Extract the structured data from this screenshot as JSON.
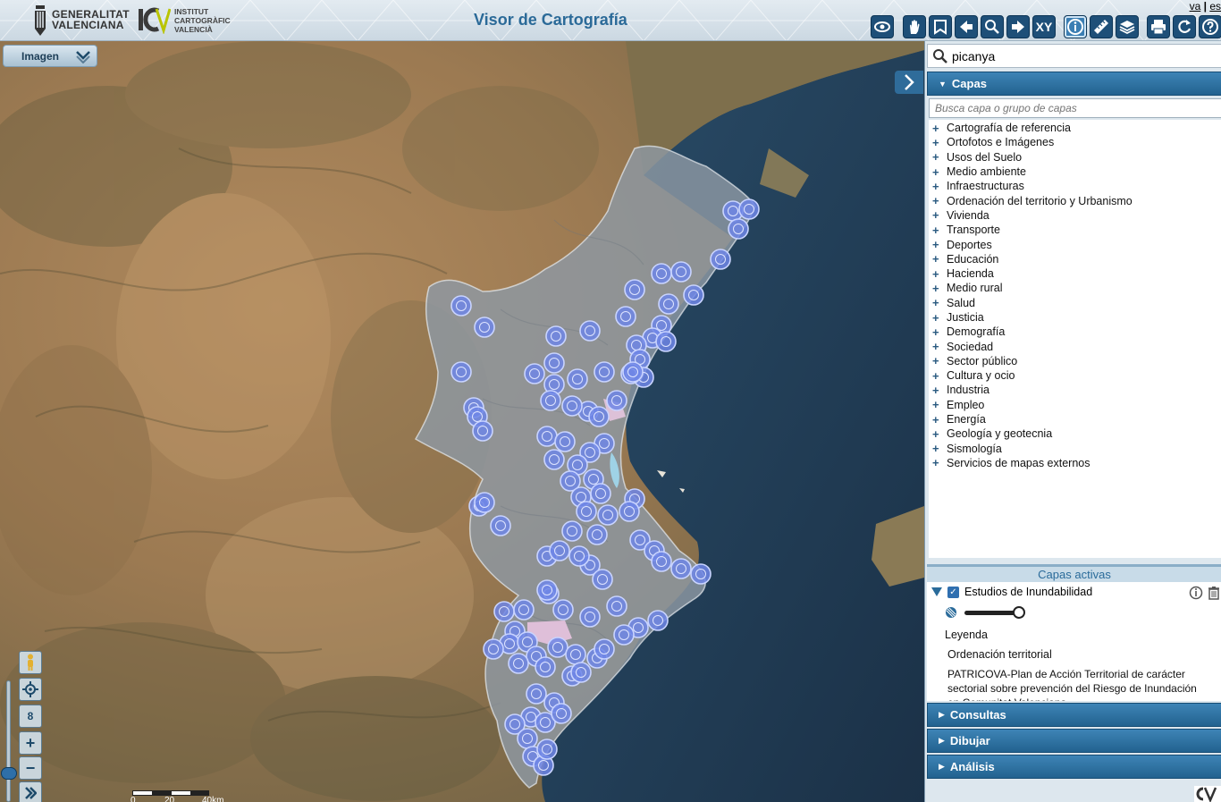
{
  "header": {
    "gva_name": [
      "GENERALITAT",
      "VALENCIANA"
    ],
    "icv_name": [
      "INSTITUT",
      "CARTOGRÀFIC",
      "VALENCIÀ"
    ],
    "title": "Visor de Cartografía",
    "lang": {
      "va": "va",
      "separator": "|",
      "es": "es"
    }
  },
  "toolbar": {
    "tools": [
      {
        "name": "eye-icon"
      },
      {
        "name": "hand-icon"
      },
      {
        "name": "bookmark-icon"
      },
      {
        "name": "arrow-left-icon"
      },
      {
        "name": "zoom-extent-icon"
      },
      {
        "name": "arrow-right-icon"
      },
      {
        "name": "xy-label",
        "label": "XY"
      },
      {
        "name": "info-icon"
      },
      {
        "name": "ruler-icon"
      },
      {
        "name": "layers-icon"
      },
      {
        "name": "print-icon"
      },
      {
        "name": "refresh-icon"
      },
      {
        "name": "help-icon"
      }
    ],
    "active_tool": "info-icon"
  },
  "map": {
    "basemap_label": "Imagen",
    "zoom_level": "8",
    "scale_labels": [
      "0",
      "20",
      "40km"
    ]
  },
  "panel": {
    "search_value": "picanya",
    "capas_title": "Capas",
    "filter_placeholder": "Busca capa o grupo de capas",
    "layer_groups": [
      "Cartografía de referencia",
      "Ortofotos e Imágenes",
      "Usos del Suelo",
      "Medio ambiente",
      "Infraestructuras",
      "Ordenación del territorio y Urbanismo",
      "Vivienda",
      "Transporte",
      "Deportes",
      "Educación",
      "Hacienda",
      "Medio rural",
      "Salud",
      "Justicia",
      "Demografía",
      "Sociedad",
      "Sector público",
      "Cultura y ocio",
      "Industria",
      "Empleo",
      "Energía",
      "Geología y geotecnia",
      "Sismología",
      "Servicios de mapas externos"
    ],
    "active_title": "Capas activas",
    "active_layer": {
      "name": "Estudios de Inundabilidad",
      "checked": true,
      "legend_label": "Leyenda",
      "category": "Ordenación territorial",
      "description": "PATRICOVA-Plan de Acción Territorial de carácter sectorial sobre prevención del Riesgo de Inundación en Comunitat Valenciana"
    },
    "sections": [
      "Consultas",
      "Dibujar",
      "Análisis"
    ]
  },
  "colors": {
    "header_accent": "#2b6a98",
    "panel_header": "#2c6fa0",
    "marker_fill": "#6f86e6",
    "region_overlay": "#8e99a3",
    "sea": "#1f3a52"
  }
}
